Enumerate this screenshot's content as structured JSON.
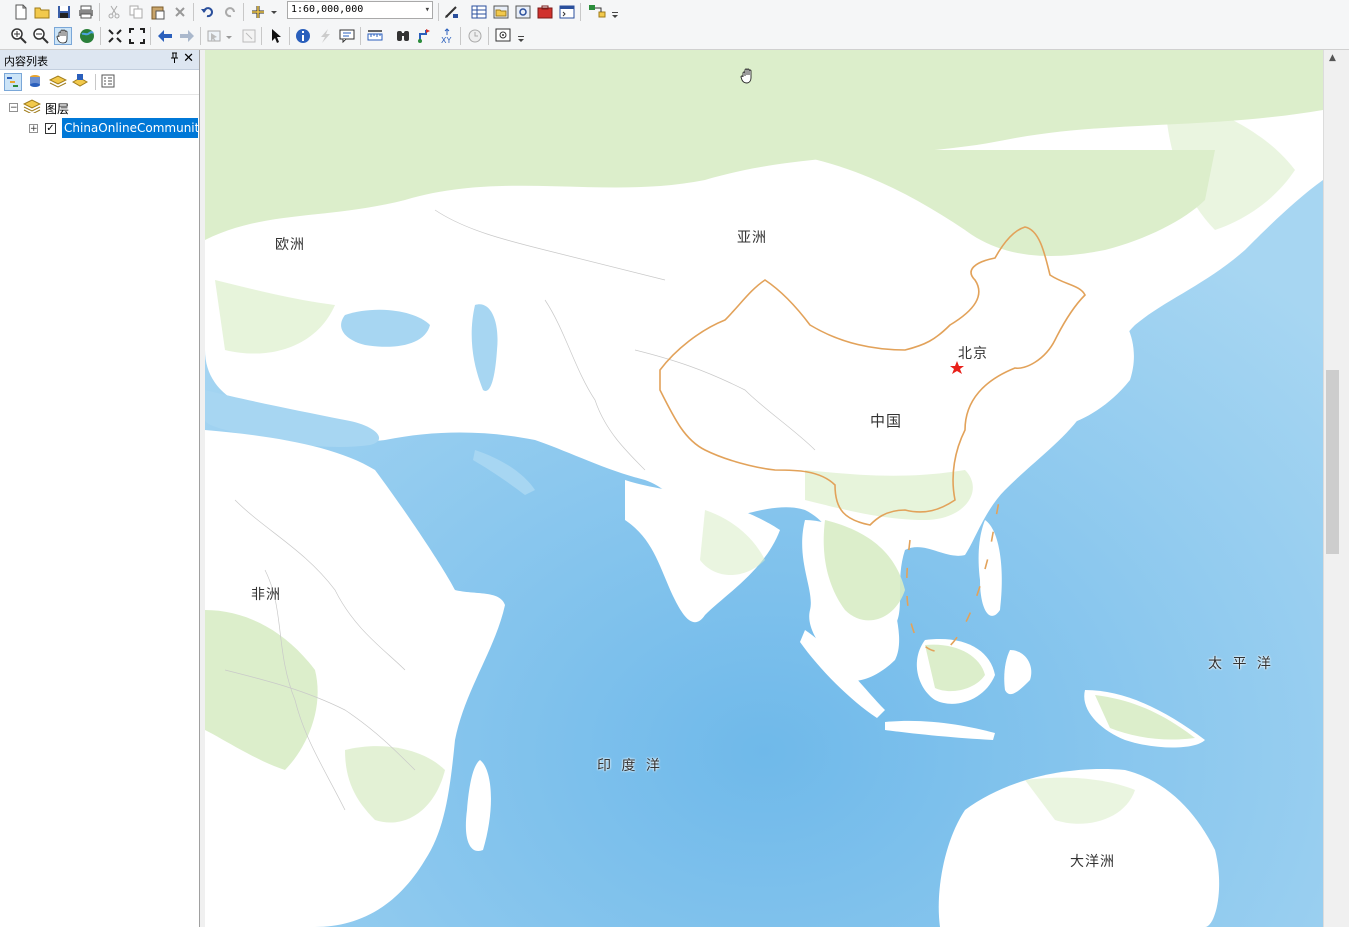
{
  "toolbar": {
    "scale_value": "1:60,000,000"
  },
  "toc": {
    "title": "内容列表",
    "pin_glyph": "ᵖ",
    "close_glyph": "✕",
    "group_label": "图层",
    "layer_label": "ChinaOnlineCommunity",
    "layer_checked": true
  },
  "map": {
    "labels": {
      "europe": "欧洲",
      "asia": "亚洲",
      "beijing": "北京",
      "china": "中国",
      "africa": "非洲",
      "indian_ocean": "印 度 洋",
      "pacific_ocean": "太 平 洋",
      "oceania": "大洋洲"
    },
    "colors": {
      "ocean": "#a7d6f2",
      "land": "#ffffff",
      "vegetation": "#d8ecc6",
      "border": "#e2a25a",
      "capital": "#e8201a"
    }
  },
  "icons": [
    "new-document-icon",
    "open-folder-icon",
    "save-icon",
    "print-icon",
    "cut-icon",
    "copy-icon",
    "paste-icon",
    "delete-icon",
    "undo-icon",
    "redo-icon",
    "add-data-icon",
    "editor-icon",
    "table-icon",
    "catalog-icon",
    "search-icon",
    "arctoolbox-icon",
    "python-icon",
    "model-icon",
    "zoom-in-icon",
    "zoom-out-icon",
    "pan-icon",
    "full-extent-icon",
    "fixed-zoom-in-icon",
    "fixed-zoom-out-icon",
    "back-icon",
    "forward-icon",
    "select-features-icon",
    "clear-selection-icon",
    "select-element-icon",
    "identify-icon",
    "hyperlink-icon",
    "html-popup-icon",
    "measure-icon",
    "find-icon",
    "find-route-icon",
    "go-to-xy-icon",
    "time-slider-icon",
    "magnifier-icon"
  ]
}
